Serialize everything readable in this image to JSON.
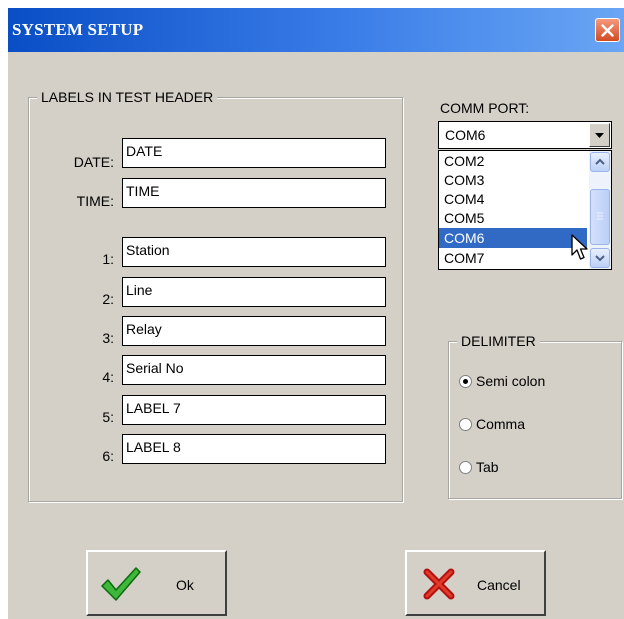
{
  "window": {
    "title": "SYSTEM SETUP"
  },
  "labels_group": {
    "legend": "LABELS IN TEST HEADER",
    "rows": [
      {
        "label": "DATE:",
        "value": "DATE"
      },
      {
        "label": "TIME:",
        "value": "TIME"
      },
      {
        "label": "1:",
        "value": "Station"
      },
      {
        "label": "2:",
        "value": "Line"
      },
      {
        "label": "3:",
        "value": "Relay"
      },
      {
        "label": "4:",
        "value": "Serial No"
      },
      {
        "label": "5:",
        "value": "LABEL 7"
      },
      {
        "label": "6:",
        "value": "LABEL 8"
      }
    ]
  },
  "comm_port": {
    "label": "COMM PORT:",
    "selected": "COM6",
    "options": [
      "COM2",
      "COM3",
      "COM4",
      "COM5",
      "COM6",
      "COM7"
    ],
    "highlighted": "COM6"
  },
  "delimiter": {
    "legend": "DELIMITER",
    "options": [
      {
        "label": "Semi colon",
        "checked": true
      },
      {
        "label": "Comma",
        "checked": false
      },
      {
        "label": "Tab",
        "checked": false
      }
    ]
  },
  "buttons": {
    "ok": "Ok",
    "cancel": "Cancel"
  },
  "icons": {
    "ok": "green-checkmark-icon",
    "cancel": "red-x-icon",
    "close": "close-icon"
  },
  "colors": {
    "titlebar": "#0a4ec6",
    "selection": "#316ac5",
    "dialog_bg": "#d4d0c8"
  }
}
